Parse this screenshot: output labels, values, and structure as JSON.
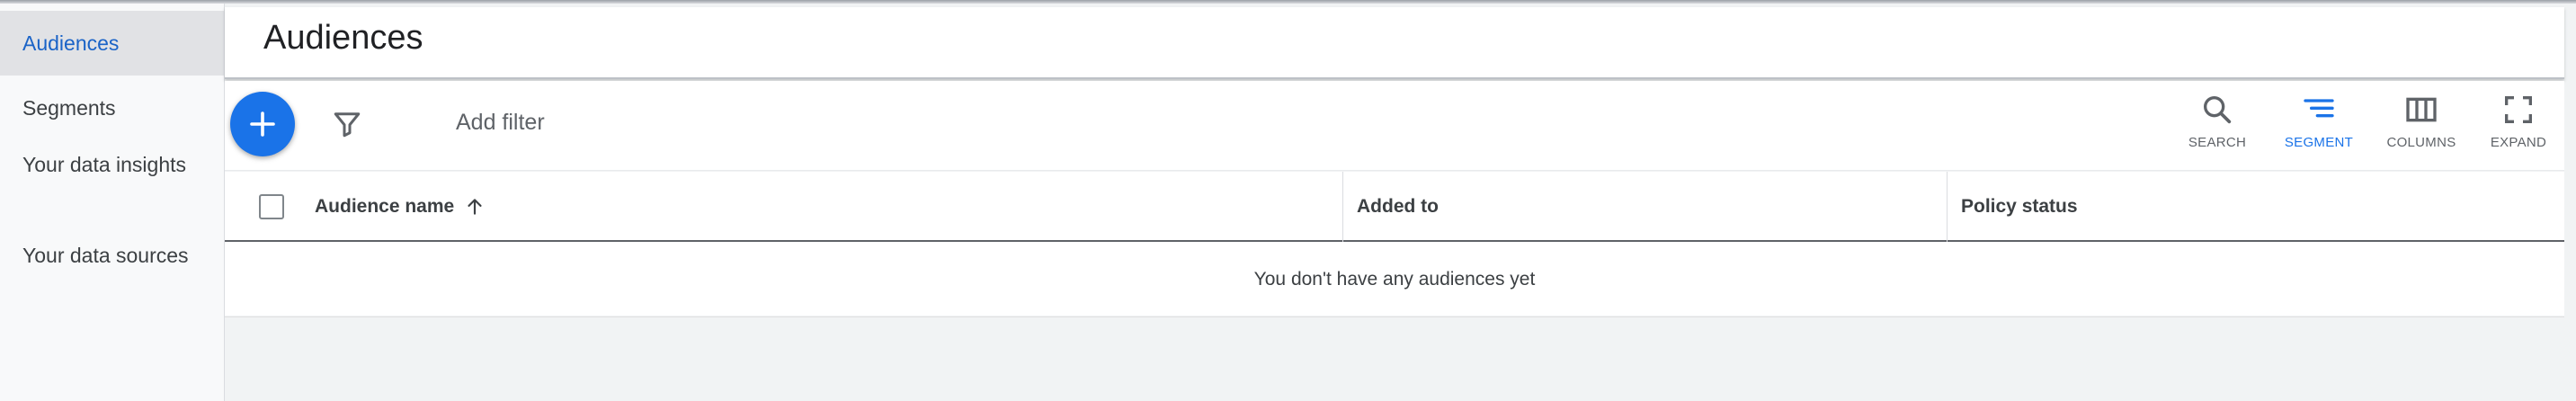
{
  "sidebar": {
    "items": [
      {
        "label": "Audiences",
        "active": true
      },
      {
        "label": "Segments"
      },
      {
        "label": "Your data insights"
      },
      {
        "label": "Your data sources"
      }
    ]
  },
  "header": {
    "title": "Audiences"
  },
  "toolbar": {
    "add_filter_label": "Add filter",
    "search_label": "SEARCH",
    "segment_label": "SEGMENT",
    "columns_label": "COLUMNS",
    "expand_label": "EXPAND"
  },
  "table": {
    "columns": [
      "Audience name",
      "Added to",
      "Policy status"
    ],
    "sort_icon": "arrow-up-icon",
    "empty_message": "You don't have any audiences yet"
  },
  "colors": {
    "accent": "#1a73e8",
    "sidebar_active_text": "#1a63c7",
    "background": "#f1f3f4"
  }
}
